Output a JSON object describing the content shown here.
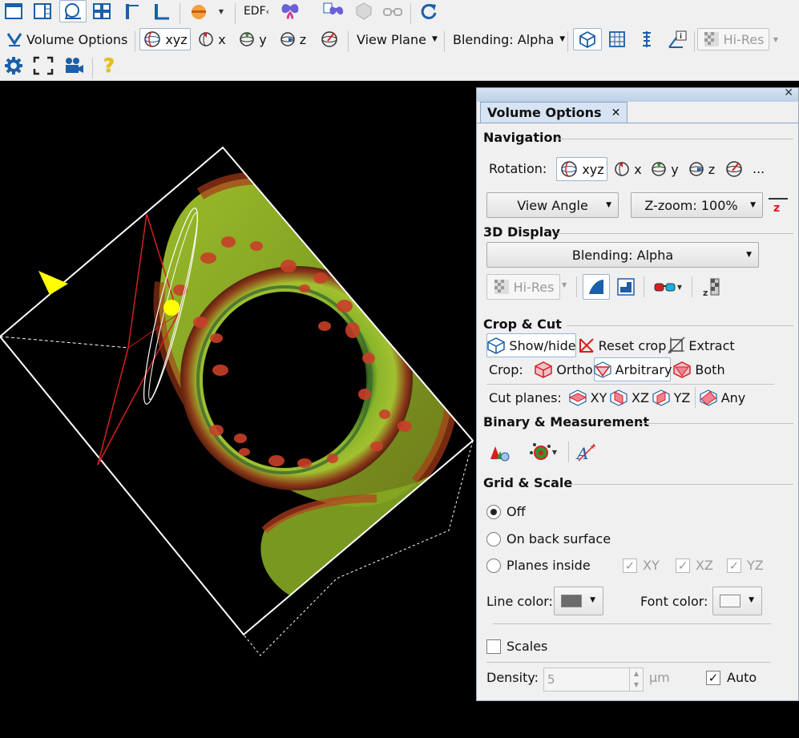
{
  "toolbar": {
    "edf_label": "EDF",
    "volume_options_label": "Volume Options",
    "rot_xyz": "xyz",
    "rot_x": "x",
    "rot_y": "y",
    "rot_z": "z",
    "view_plane_label": "View Plane",
    "blending_label": "Blending: Alpha",
    "hires_label": "Hi-Res",
    "help_glyph": "?"
  },
  "panel": {
    "tab_title": "Volume Options",
    "tab_close": "✕",
    "titlebar_close": "✕",
    "navigation": {
      "title": "Navigation",
      "rotation_label": "Rotation:",
      "rot_xyz": "xyz",
      "rot_x": "x",
      "rot_y": "y",
      "rot_z": "z",
      "more": "...",
      "view_angle": "View Angle",
      "zzoom": "Z-zoom: 100%",
      "z_glyph": "z"
    },
    "display": {
      "title": "3D Display",
      "blending": "Blending: Alpha",
      "hires": "Hi-Res"
    },
    "crop": {
      "title": "Crop & Cut",
      "show_hide": "Show/hide",
      "reset_crop": "Reset crop",
      "extract": "Extract",
      "crop_label": "Crop:",
      "ortho": "Ortho",
      "arbitrary": "Arbitrary",
      "both": "Both",
      "cut_planes_label": "Cut planes:",
      "xy": "XY",
      "xz": "XZ",
      "yz": "YZ",
      "any": "Any"
    },
    "binary": {
      "title": "Binary & Measurement"
    },
    "grid": {
      "title": "Grid & Scale",
      "off": "Off",
      "on_back": "On back surface",
      "planes_inside": "Planes inside",
      "xy": "XY",
      "xz": "XZ",
      "yz": "YZ",
      "line_color_label": "Line color:",
      "font_color_label": "Font color:",
      "line_color": "#6b6b6b",
      "font_color": "#f7f7f7",
      "scales": "Scales",
      "density_label": "Density:",
      "density_value": "5",
      "unit": "µm",
      "auto": "Auto",
      "selected": "Off"
    }
  },
  "colors": {
    "toolbar_bg": "#f0f0f0",
    "panel_bg": "#f0f0f0",
    "tab_bg": "#d6e3f3",
    "accent_blue": "#1a5fa8",
    "bbox": "#ffffff",
    "plane_red": "#d42020",
    "marker_yellow": "#ffff00"
  }
}
